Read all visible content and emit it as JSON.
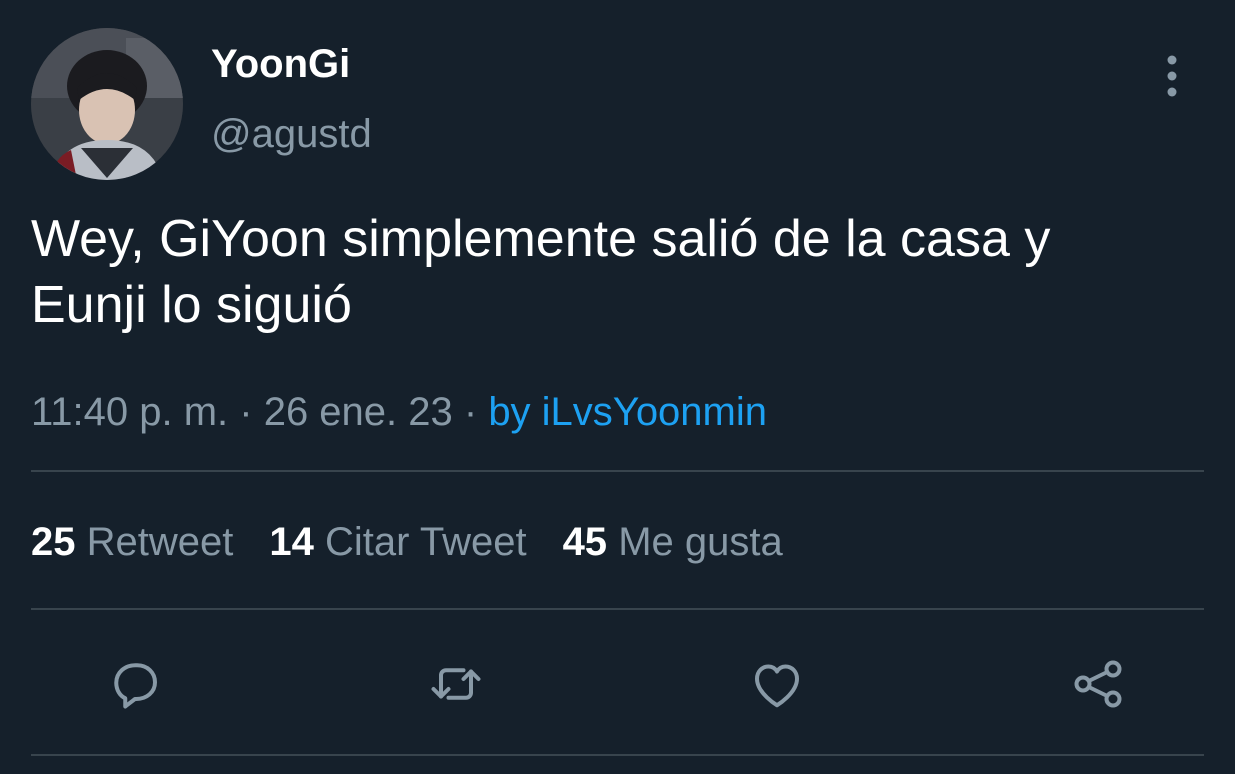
{
  "user": {
    "display_name": "YoonGi",
    "handle": "@agustd"
  },
  "tweet": {
    "text_line1": "Wey, GiYoon simplemente salió de la casa y",
    "text_line2": "Eunji lo siguió"
  },
  "meta": {
    "time": "11:40 p. m.",
    "sep1": " · ",
    "date": "26 ene. 23",
    "sep2": " · ",
    "source": "by iLvsYoonmin"
  },
  "stats": {
    "retweets_count": "25",
    "retweets_label": "Retweet",
    "quotes_count": "14",
    "quotes_label": "Citar Tweet",
    "likes_count": "45",
    "likes_label": "Me gusta"
  },
  "icons": {
    "more": "more-vertical-icon",
    "reply": "reply-icon",
    "retweet": "retweet-icon",
    "like": "heart-icon",
    "share": "share-icon"
  },
  "colors": {
    "background": "#15202b",
    "text": "#ffffff",
    "secondary": "#8899a6",
    "accent": "#1da1f2",
    "divider": "#38444d"
  }
}
